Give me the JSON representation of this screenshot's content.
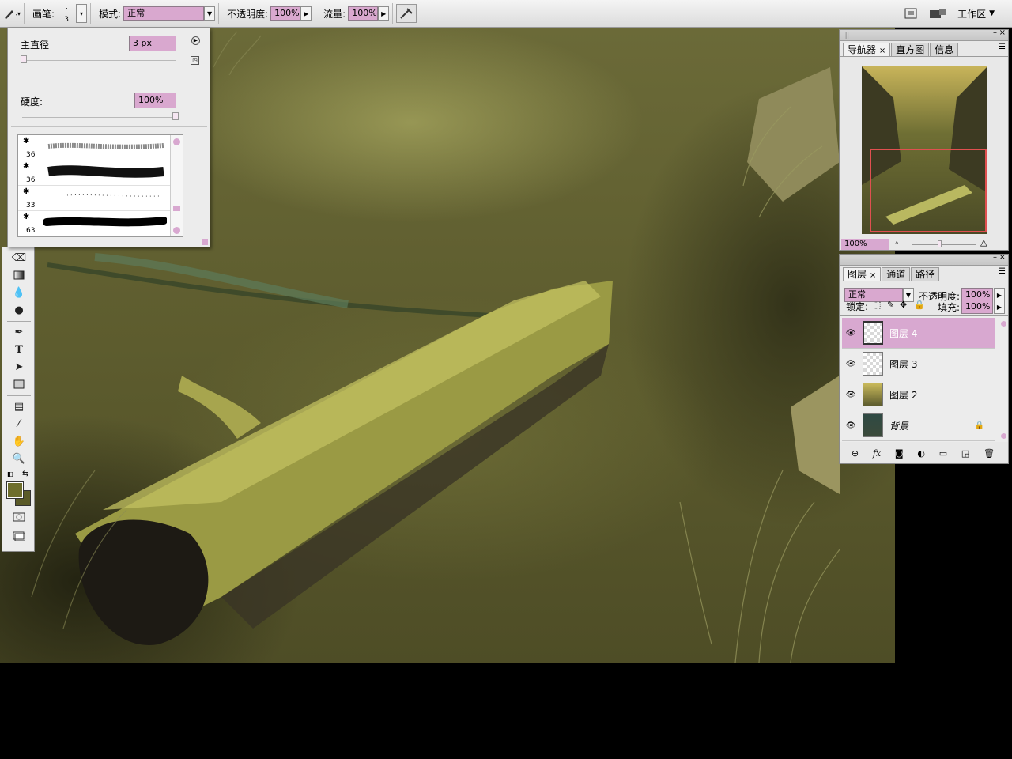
{
  "options_bar": {
    "brush_label": "画笔:",
    "brush_size": "3",
    "mode_label": "模式:",
    "mode_value": "正常",
    "opacity_label": "不透明度:",
    "opacity_value": "100%",
    "flow_label": "流量:",
    "flow_value": "100%",
    "workspace_label": "工作区"
  },
  "brush_popup": {
    "master_diameter_label": "主直径",
    "master_diameter_value": "3 px",
    "diameter_level": 0.01,
    "hardness_label": "硬度:",
    "hardness_value": "100%",
    "hardness_level": 1.0,
    "presets": [
      {
        "size": "36"
      },
      {
        "size": "36"
      },
      {
        "size": "33"
      },
      {
        "size": "63"
      }
    ]
  },
  "navigator": {
    "tabs": [
      {
        "label": "导航器"
      },
      {
        "label": "直方图"
      },
      {
        "label": "信息"
      }
    ],
    "zoom_value": "100%"
  },
  "layers_panel": {
    "tabs": [
      {
        "label": "图层"
      },
      {
        "label": "通道"
      },
      {
        "label": "路径"
      }
    ],
    "blend_mode": "正常",
    "opacity_label": "不透明度:",
    "opacity_value": "100%",
    "lock_label": "锁定:",
    "fill_label": "填充:",
    "fill_value": "100%",
    "layers": [
      {
        "name": "图层 4"
      },
      {
        "name": "图层 3"
      },
      {
        "name": "图层 2"
      },
      {
        "name": "背景"
      }
    ]
  },
  "colors": {
    "accent": "#d8a8d0",
    "foreground": "#6e6e2c",
    "background": "#5a5a28"
  }
}
